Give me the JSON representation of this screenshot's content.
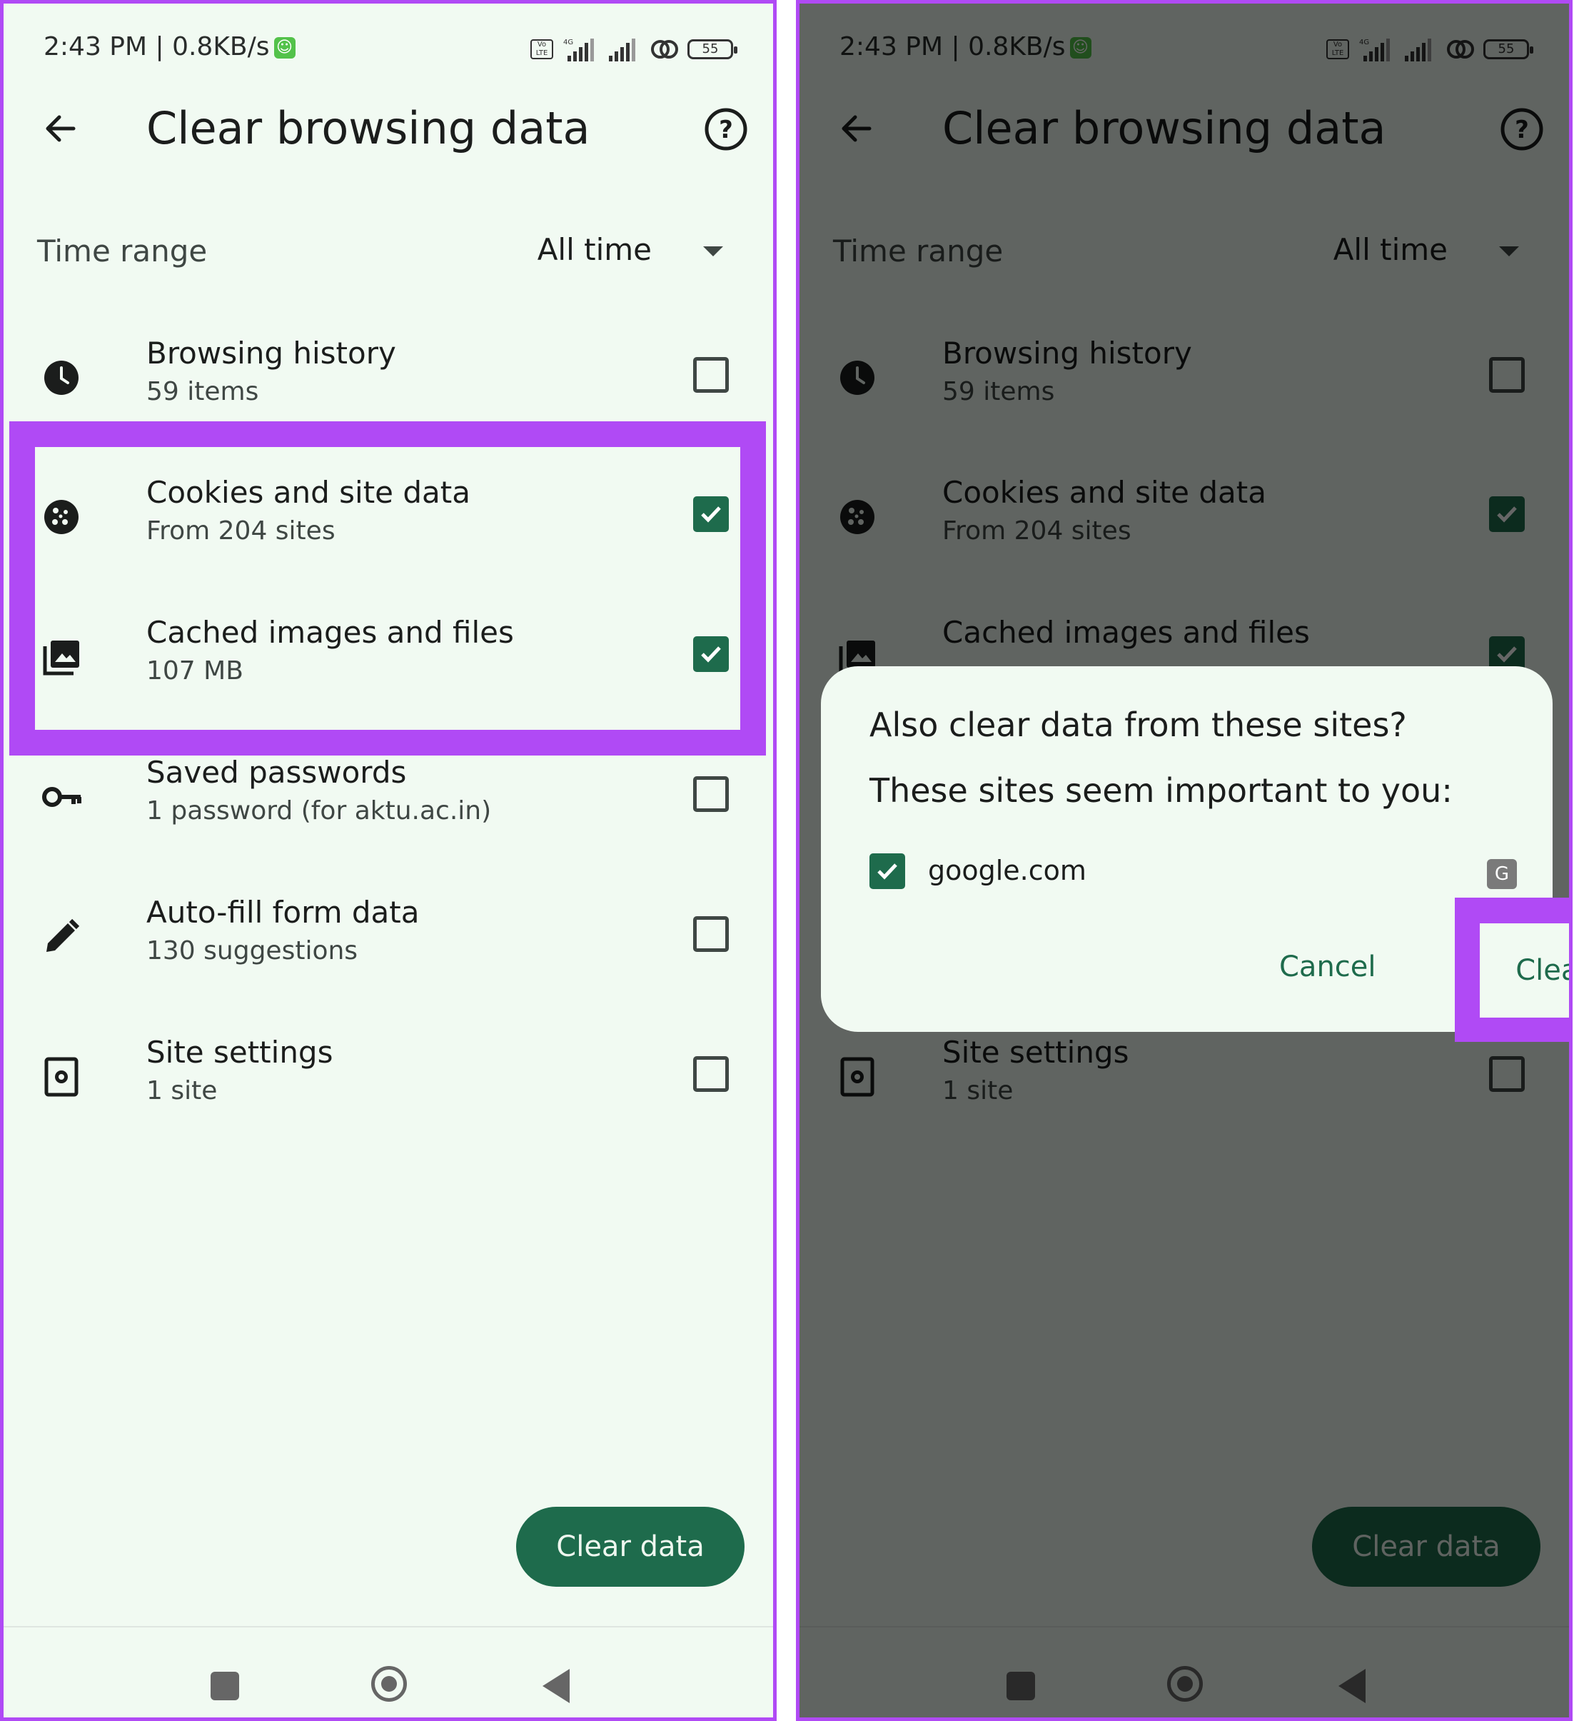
{
  "colors": {
    "accent": "#1e6b4c",
    "highlight": "#b04af5",
    "background": "#f1faf2"
  },
  "status": {
    "time": "2:43 PM | 0.8KB/s",
    "network": "4G",
    "battery": "55"
  },
  "appbar": {
    "title": "Clear browsing data"
  },
  "time_range": {
    "label": "Time range",
    "value": "All time"
  },
  "items": [
    {
      "title": "Browsing history",
      "subtitle": "59 items",
      "checked": false,
      "icon": "clock-icon"
    },
    {
      "title": "Cookies and site data",
      "subtitle": "From 204 sites",
      "checked": true,
      "icon": "cookie-icon"
    },
    {
      "title": "Cached images and files",
      "subtitle": "107 MB",
      "checked": true,
      "icon": "image-icon"
    },
    {
      "title": "Saved passwords",
      "subtitle": "1 password (for aktu.ac.in)",
      "checked": false,
      "icon": "key-icon"
    },
    {
      "title": "Auto-fill form data",
      "subtitle": "130 suggestions",
      "checked": false,
      "icon": "pencil-icon"
    },
    {
      "title": "Site settings",
      "subtitle": "1 site",
      "checked": false,
      "icon": "site-settings-icon"
    }
  ],
  "clear_button": "Clear data",
  "dialog": {
    "title": "Also clear data from these sites?",
    "subtitle": "These sites seem important to you:",
    "site": "google.com",
    "site_favicon": "G",
    "cancel": "Cancel",
    "clear": "Clear"
  }
}
